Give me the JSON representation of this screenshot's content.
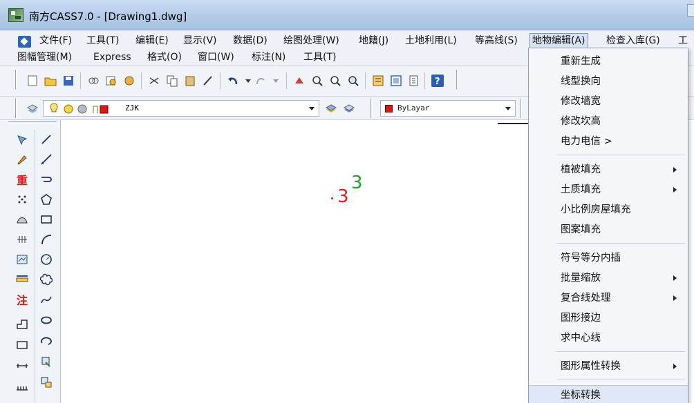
{
  "window": {
    "title": "南方CASS7.0 - [Drawing1.dwg]"
  },
  "menubar": {
    "row1": [
      {
        "id": "file",
        "label": "文件(F)"
      },
      {
        "id": "tools",
        "label": "工具(T)"
      },
      {
        "id": "edit",
        "label": "编辑(E)"
      },
      {
        "id": "display",
        "label": "显示(V)"
      },
      {
        "id": "data",
        "label": "数据(D)"
      },
      {
        "id": "mapping",
        "label": "绘图处理(W)"
      },
      {
        "id": "cadastre",
        "label": "地籍(J)"
      },
      {
        "id": "landuse",
        "label": "土地利用(L)"
      },
      {
        "id": "contour",
        "label": "等高线(S)"
      },
      {
        "id": "feature-edit",
        "label": "地物编辑(A)"
      },
      {
        "id": "check-db",
        "label": "检查入库(G)"
      },
      {
        "id": "cut",
        "label": "工"
      }
    ],
    "row2": [
      {
        "id": "sheet-mgmt",
        "label": "图幅管理(M)"
      },
      {
        "id": "express",
        "label": "Express"
      },
      {
        "id": "format",
        "label": "格式(O)"
      },
      {
        "id": "window",
        "label": "窗口(W)"
      },
      {
        "id": "dimension",
        "label": "标注(N)"
      },
      {
        "id": "tools2",
        "label": "工具(T)"
      }
    ]
  },
  "toolbar": {
    "layer_name": "ZJK",
    "color_value": "ByLayar"
  },
  "canvas": {
    "label_red": "3",
    "label_green": "3"
  },
  "dropdown": {
    "items": [
      {
        "label": "重新生成",
        "submenu": false
      },
      {
        "label": "线型换向",
        "submenu": false
      },
      {
        "label": "修改墙宽",
        "submenu": false
      },
      {
        "label": "修改坎高",
        "submenu": false
      },
      {
        "label": "电力电信 >",
        "submenu": false
      },
      {
        "label": "植被填充",
        "submenu": true
      },
      {
        "label": "土质填充",
        "submenu": true
      },
      {
        "label": "小比例房屋填充",
        "submenu": false
      },
      {
        "label": "图案填充",
        "submenu": false
      },
      {
        "label": "符号等分内插",
        "submenu": false
      },
      {
        "label": "批量缩放",
        "submenu": true
      },
      {
        "label": "复合线处理",
        "submenu": true
      },
      {
        "label": "图形接边",
        "submenu": false
      },
      {
        "label": "求中心线",
        "submenu": false
      },
      {
        "label": "图形属性转换",
        "submenu": true
      },
      {
        "label": "坐标转换",
        "submenu": false
      }
    ]
  },
  "left_toolbar": {
    "cass_text_symbols": [
      "重",
      "注"
    ]
  },
  "colors": {
    "accent_red": "#d81818",
    "canvas_red": "#e02020",
    "canvas_green": "#23a323",
    "help_blue": "#2d5fae"
  }
}
